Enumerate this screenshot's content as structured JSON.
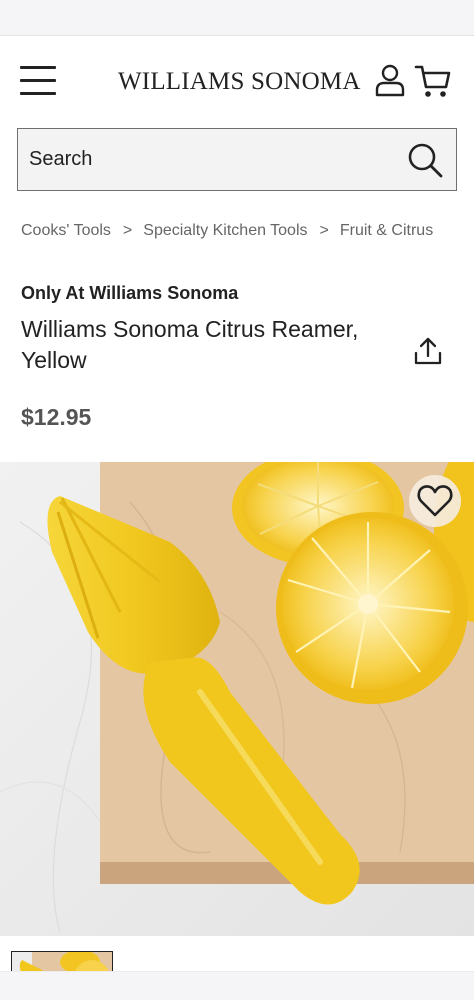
{
  "header": {
    "brand": "WILLIAMS SONOMA",
    "menu_icon": "hamburger-menu-icon",
    "account_icon": "user-icon",
    "cart_icon": "shopping-cart-icon"
  },
  "search": {
    "placeholder": "Search",
    "icon": "search-icon"
  },
  "breadcrumb": [
    {
      "label": "Cooks' Tools"
    },
    {
      "label": "Specialty Kitchen Tools"
    },
    {
      "label": "Fruit & Citrus"
    }
  ],
  "breadcrumb_separator": ">",
  "product": {
    "badge": "Only At Williams Sonoma",
    "title": "Williams Sonoma Citrus Reamer, Yellow",
    "price": "$12.95",
    "share_icon": "share-icon",
    "favorite_icon": "heart-icon"
  },
  "colors": {
    "text": "#222222",
    "price": "#555555",
    "breadcrumb": "#666666",
    "search_bg": "#f3f3f3",
    "reamer_yellow": "#f2cc2a",
    "board_wood": "#e2c3a0",
    "marble": "#ececec"
  }
}
